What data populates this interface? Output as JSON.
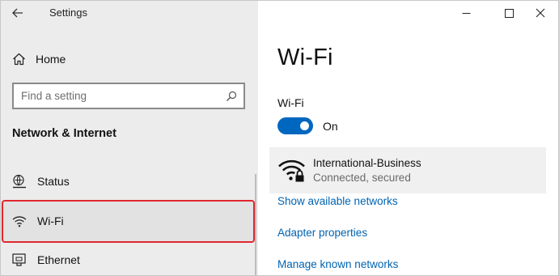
{
  "window": {
    "app_title": "Settings",
    "controls": {
      "minimize": "minimize-icon",
      "maximize": "maximize-icon",
      "close": "close-icon"
    }
  },
  "sidebar": {
    "home": "Home",
    "search_placeholder": "Find a setting",
    "section_title": "Network & Internet",
    "items": [
      {
        "label": "Status",
        "icon": "status-icon"
      },
      {
        "label": "Wi-Fi",
        "icon": "wifi-icon",
        "selected": true
      },
      {
        "label": "Ethernet",
        "icon": "ethernet-icon"
      }
    ]
  },
  "main": {
    "title": "Wi-Fi",
    "wifi_label": "Wi-Fi",
    "toggle_state": "On",
    "network": {
      "name": "International-Business",
      "status": "Connected, secured"
    },
    "links": {
      "show_networks": "Show available networks",
      "adapter": "Adapter properties",
      "manage": "Manage known networks"
    }
  },
  "colors": {
    "accent": "#0067c0",
    "link": "#0063b1",
    "highlight_border": "#e0282e",
    "sidebar_bg": "#ececec"
  }
}
